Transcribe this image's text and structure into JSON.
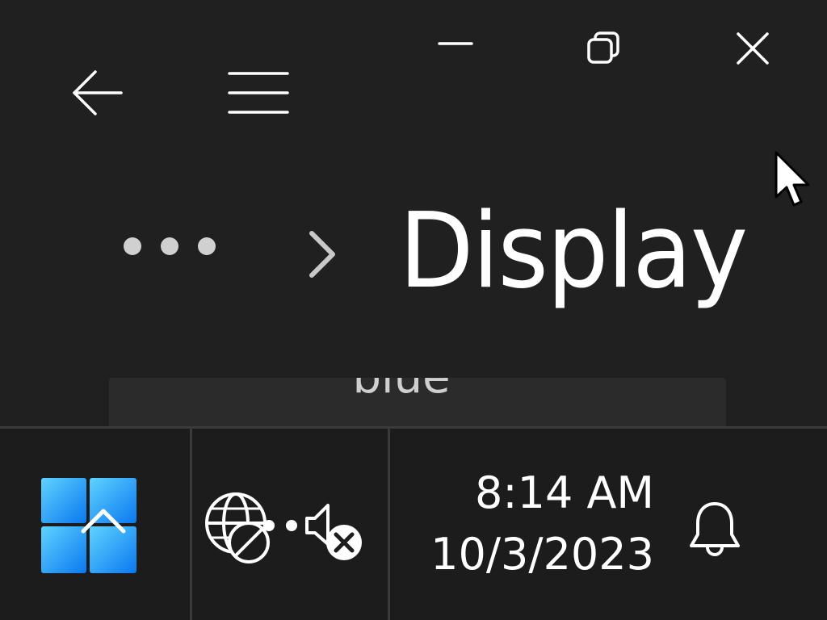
{
  "window": {
    "caption_buttons": {
      "minimize_icon": "minimize-icon",
      "restore_icon": "restore-icon",
      "close_icon": "close-icon"
    },
    "nav": {
      "back_icon": "back-arrow-icon",
      "menu_icon": "hamburger-menu-icon"
    },
    "breadcrumb": {
      "more_icon": "more-icon",
      "separator_icon": "chevron-right-icon",
      "current_page": "Display"
    },
    "list_card": {
      "text": "blue"
    }
  },
  "taskbar": {
    "start_icon": "windows-logo-icon",
    "start_overlay_icon": "chevron-up-icon",
    "tray": {
      "network_icon": "globe-no-connection-icon",
      "volume_icon": "volume-muted-icon"
    },
    "clock": {
      "time": "8:14 AM",
      "date": "10/3/2023"
    },
    "notifications_icon": "bell-icon"
  },
  "colors": {
    "background": "#202020",
    "taskbar": "#1c1c1c",
    "card": "#2b2b2b",
    "accent_blue": "#1e90ff",
    "text": "#ffffff",
    "muted": "#cfcfcf"
  }
}
